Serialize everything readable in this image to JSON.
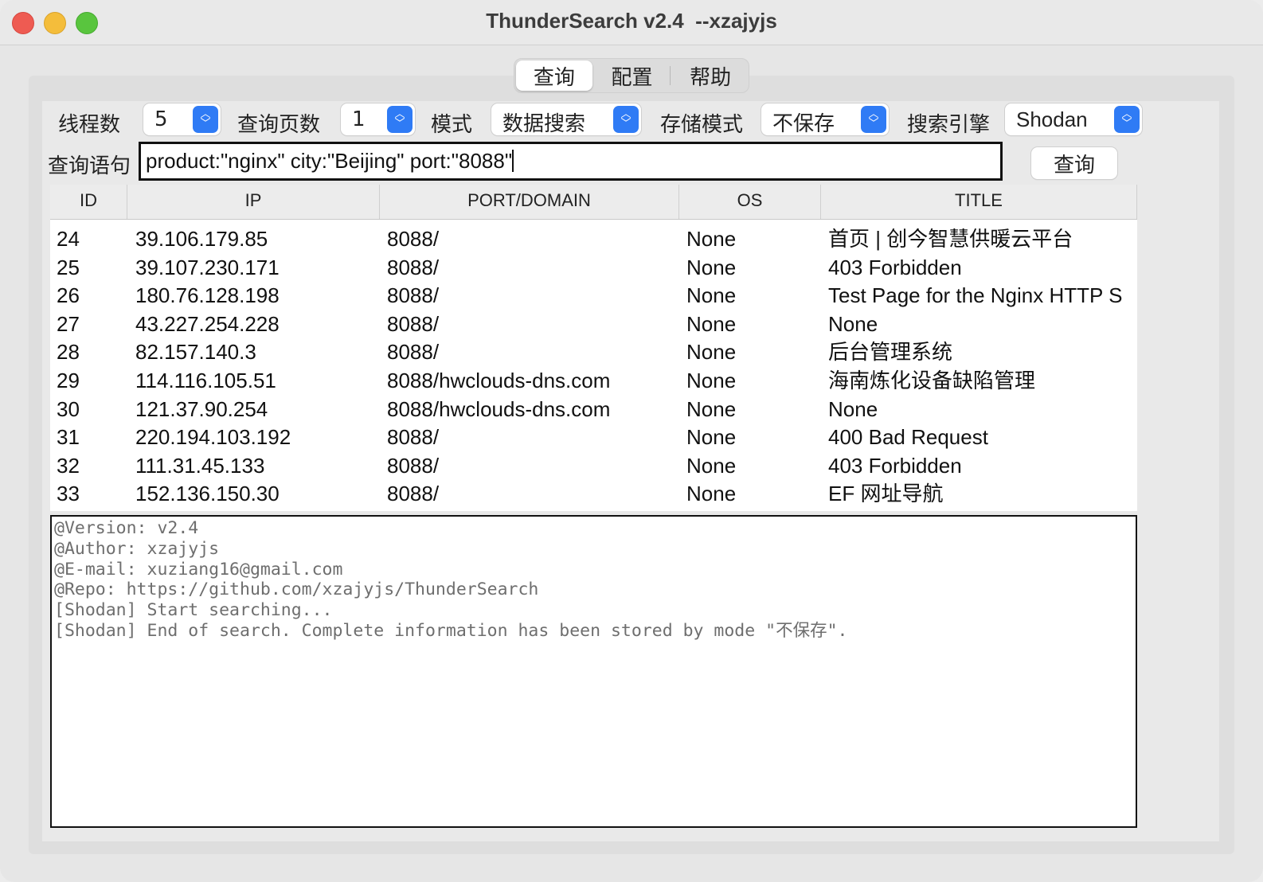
{
  "window": {
    "title": "ThunderSearch v2.4  --xzajyjs"
  },
  "tabs": [
    {
      "label": "查询",
      "active": true
    },
    {
      "label": "配置",
      "active": false
    },
    {
      "label": "帮助",
      "active": false
    }
  ],
  "controls": {
    "threads_label": "线程数",
    "threads_value": "5",
    "pages_label": "查询页数",
    "pages_value": "1",
    "mode_label": "模式",
    "mode_value": "数据搜索",
    "storage_label": "存储模式",
    "storage_value": "不保存",
    "engine_label": "搜索引擎",
    "engine_value": "Shodan",
    "query_label": "查询语句",
    "query_value": "product:\"nginx\" city:\"Beijing\" port:\"8088\"",
    "query_button": "查询"
  },
  "table": {
    "headers": [
      "ID",
      "IP",
      "PORT/DOMAIN",
      "OS",
      "TITLE"
    ],
    "rows": [
      [
        "24",
        "39.106.179.85",
        "8088/",
        "None",
        "首页 | 创今智慧供暖云平台"
      ],
      [
        "25",
        "39.107.230.171",
        "8088/",
        "None",
        "403 Forbidden"
      ],
      [
        "26",
        "180.76.128.198",
        "8088/",
        "None",
        "Test Page for the Nginx HTTP S"
      ],
      [
        "27",
        "43.227.254.228",
        "8088/",
        "None",
        "None"
      ],
      [
        "28",
        "82.157.140.3",
        "8088/",
        "None",
        "后台管理系统"
      ],
      [
        "29",
        "114.116.105.51",
        "8088/hwclouds-dns.com",
        "None",
        "海南炼化设备缺陷管理"
      ],
      [
        "30",
        "121.37.90.254",
        "8088/hwclouds-dns.com",
        "None",
        "None"
      ],
      [
        "31",
        "220.194.103.192",
        "8088/",
        "None",
        "400 Bad Request"
      ],
      [
        "32",
        "111.31.45.133",
        "8088/",
        "None",
        "403 Forbidden"
      ],
      [
        "33",
        "152.136.150.30",
        "8088/",
        "None",
        "EF 网址导航"
      ]
    ]
  },
  "log": [
    "@Version: v2.4",
    "@Author: xzajyjs",
    "@E-mail: xuziang16@gmail.com",
    "@Repo: https://github.com/xzajyjs/ThunderSearch",
    "[Shodan] Start searching...",
    "[Shodan] End of search. Complete information has been stored by mode \"不保存\"."
  ]
}
